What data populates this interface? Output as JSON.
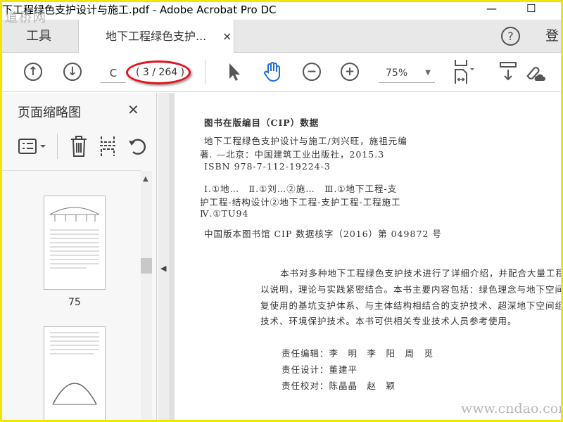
{
  "window": {
    "title": "下工程绿色支护设计与施工.pdf - Adobe Acrobat Pro DC",
    "minimize": "—",
    "maximize": "☐"
  },
  "tabs": {
    "tools": "工具",
    "document": "地下工程绿色支护...",
    "close": "×",
    "help": "?",
    "login": "登"
  },
  "toolbar": {
    "page_input": "C",
    "page_count": "( 3 / 264 )",
    "zoom": "75%",
    "annotation_color": "#e0141e",
    "hand_color": "#1f6fd1"
  },
  "sidebar": {
    "title": "页面缩略图",
    "close": "✕",
    "thumbnails": [
      {
        "label": "75"
      },
      {
        "label": ""
      }
    ]
  },
  "page": {
    "cip_title": "图书在版编目（CIP）数据",
    "lines": [
      "地下工程绿色支护设计与施工/刘兴旺，施祖元编",
      "著. —北京：中国建筑工业出版社，2015.3",
      "ISBN 978-7-112-19224-3"
    ],
    "subject_lines": [
      "Ⅰ.①地…　Ⅱ.①刘…②施…　Ⅲ.①地下工程-支",
      "护工程-结构设计②地下工程-支护工程-工程施工",
      "Ⅳ.①TU94"
    ],
    "cip_number": "中国版本图书馆 CIP 数据核字（2016）第 049872 号",
    "summary": [
      "本书对多种地下工程绿色支护技术进行了详细介绍，并配合大量工程实例",
      "以说明，理论与实践紧密结合。本书主要内容包括：绿色理念与地下空间、可",
      "复使用的基坑支护体系、与主体结构相结合的支护技术、超深地下空间组合支",
      "技术、环境保护技术。本书可供相关专业技术人员参考使用。"
    ],
    "credits": [
      "责任编辑：李　明　李　阳　周　觅",
      "责任设计：董建平",
      "责任校对：陈晶晶　赵　颖"
    ]
  },
  "watermarks": {
    "top": "道桥网",
    "bottom": "www.cndao.com"
  }
}
